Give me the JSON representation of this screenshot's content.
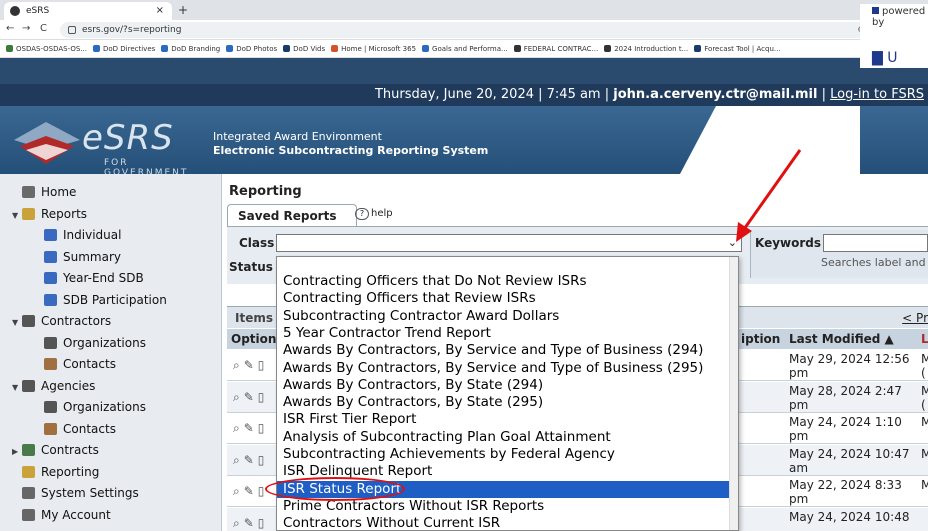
{
  "browser": {
    "tab_title": "eSRS",
    "tab_close": "×",
    "new_tab": "+",
    "url": "esrs.gov/?s=reporting",
    "bookmarks": [
      {
        "label": "OSDAS-OSDAS-OS...",
        "color": "#3a7a3a"
      },
      {
        "label": "DoD Directives",
        "color": "#2a6abf"
      },
      {
        "label": "DoD Branding",
        "color": "#2a6abf"
      },
      {
        "label": "DoD Photos",
        "color": "#2a6abf"
      },
      {
        "label": "DoD Vids",
        "color": "#1a3a6a"
      },
      {
        "label": "Home | Microsoft 365",
        "color": "#d8502a"
      },
      {
        "label": "Goals and Performa...",
        "color": "#2a6abf"
      },
      {
        "label": "FEDERAL CONTRAC...",
        "color": "#333333"
      },
      {
        "label": "2024 Introduction t...",
        "color": "#333333"
      },
      {
        "label": "Forecast Tool | Acqu...",
        "color": "#1a3a6a"
      }
    ]
  },
  "header": {
    "date_text": "Thursday, June 20, 2024 | 7:45 am | ",
    "user": "john.a.cerveny.ctr@mail.mil",
    "sep": " | ",
    "login_link": "Log-in to FSRS",
    "logo": "eSRS",
    "logo_sub": "FOR GOVERNMENT",
    "title_line1": "Integrated Award Environment",
    "title_line2": "Electronic Subcontracting Reporting System",
    "powered": "powered by"
  },
  "sidebar": {
    "items": [
      {
        "label": "Home",
        "level": 0
      },
      {
        "label": "Reports",
        "level": 0
      },
      {
        "label": "Individual",
        "level": 1
      },
      {
        "label": "Summary",
        "level": 1
      },
      {
        "label": "Year-End SDB",
        "level": 1
      },
      {
        "label": "SDB Participation",
        "level": 1
      },
      {
        "label": "Contractors",
        "level": 0
      },
      {
        "label": "Organizations",
        "level": 1
      },
      {
        "label": "Contacts",
        "level": 1
      },
      {
        "label": "Agencies",
        "level": 0
      },
      {
        "label": "Organizations",
        "level": 1
      },
      {
        "label": "Contacts",
        "level": 1
      },
      {
        "label": "Contracts",
        "level": 0
      },
      {
        "label": "Reporting",
        "level": 0
      },
      {
        "label": "System Settings",
        "level": 0
      },
      {
        "label": "My Account",
        "level": 0
      }
    ]
  },
  "main": {
    "heading": "Reporting",
    "tab": "Saved Reports",
    "help": "help",
    "class_label": "Class",
    "status_label": "Status",
    "keywords_label": "Keywords",
    "keywords_hint": "Searches label and d",
    "items_label": "Items",
    "prev_link": "< Pr",
    "columns": {
      "options": "Options",
      "description": "iption",
      "last_modified": "Last Modified ▲",
      "last": "L"
    },
    "rows": [
      {
        "mod": "May 29, 2024 12:56 pm",
        "l": "M ("
      },
      {
        "mod": "May 28, 2024 2:47 pm",
        "l": "M ("
      },
      {
        "mod": "May 24, 2024 1:10 pm",
        "l": "M"
      },
      {
        "mod": "May 24, 2024 10:47 am",
        "l": "M"
      },
      {
        "mod": "May 22, 2024 8:33 pm",
        "l": "M"
      },
      {
        "mod": "May 24, 2024 10:48",
        "l": ""
      }
    ]
  },
  "dropdown": {
    "options": [
      "Contracting Officers that Do Not Review ISRs",
      "Contracting Officers that Review ISRs",
      "Subcontracting Contractor Award Dollars",
      "5 Year Contractor Trend Report",
      "Awards By Contractors, By Service and Type of Business (294)",
      "Awards By Contractors, By Service and Type of Business (295)",
      "Awards By Contractors, By State (294)",
      "Awards By Contractors, By State (295)",
      "ISR First Tier Report",
      "Analysis of Subcontracting Plan Goal Attainment",
      "Subcontracting Achievements by Federal Agency",
      "ISR Delinquent Report",
      "ISR Status Report",
      "Prime Contractors Without ISR Reports",
      "Contractors Without Current ISR"
    ],
    "selected_index": 12,
    "highlight_color": "#1f5ec4"
  },
  "annotation_color": "#e01010"
}
